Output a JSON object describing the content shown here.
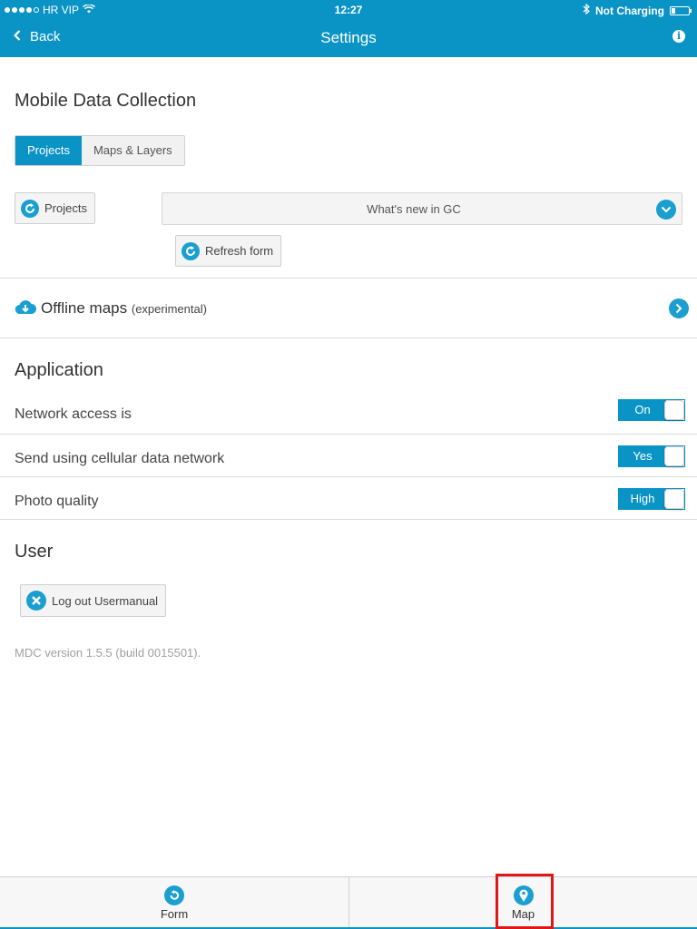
{
  "status_bar": {
    "carrier": "HR VIP",
    "time": "12:27",
    "charging": "Not Charging"
  },
  "nav": {
    "back_label": "Back",
    "title": "Settings"
  },
  "mdc": {
    "title": "Mobile Data Collection",
    "tabs": [
      "Projects",
      "Maps & Layers"
    ],
    "projects_button": "Projects",
    "project_select_value": "What's new in GC",
    "refresh_button": "Refresh form"
  },
  "offline_maps": {
    "label": "Offline maps",
    "sub": "(experimental)"
  },
  "application": {
    "title": "Application",
    "rows": [
      {
        "label": "Network access is",
        "toggle": "On"
      },
      {
        "label": "Send using cellular data network",
        "toggle": "Yes"
      },
      {
        "label": "Photo quality",
        "toggle": "High"
      }
    ]
  },
  "user": {
    "title": "User",
    "logout_button": "Log out Usermanual"
  },
  "version": "MDC version 1.5.5 (build 0015501).",
  "tabbar": {
    "tabs": [
      "Form",
      "Map"
    ]
  },
  "colors": {
    "accent": "#0a94c6",
    "highlight": "#e01717"
  }
}
